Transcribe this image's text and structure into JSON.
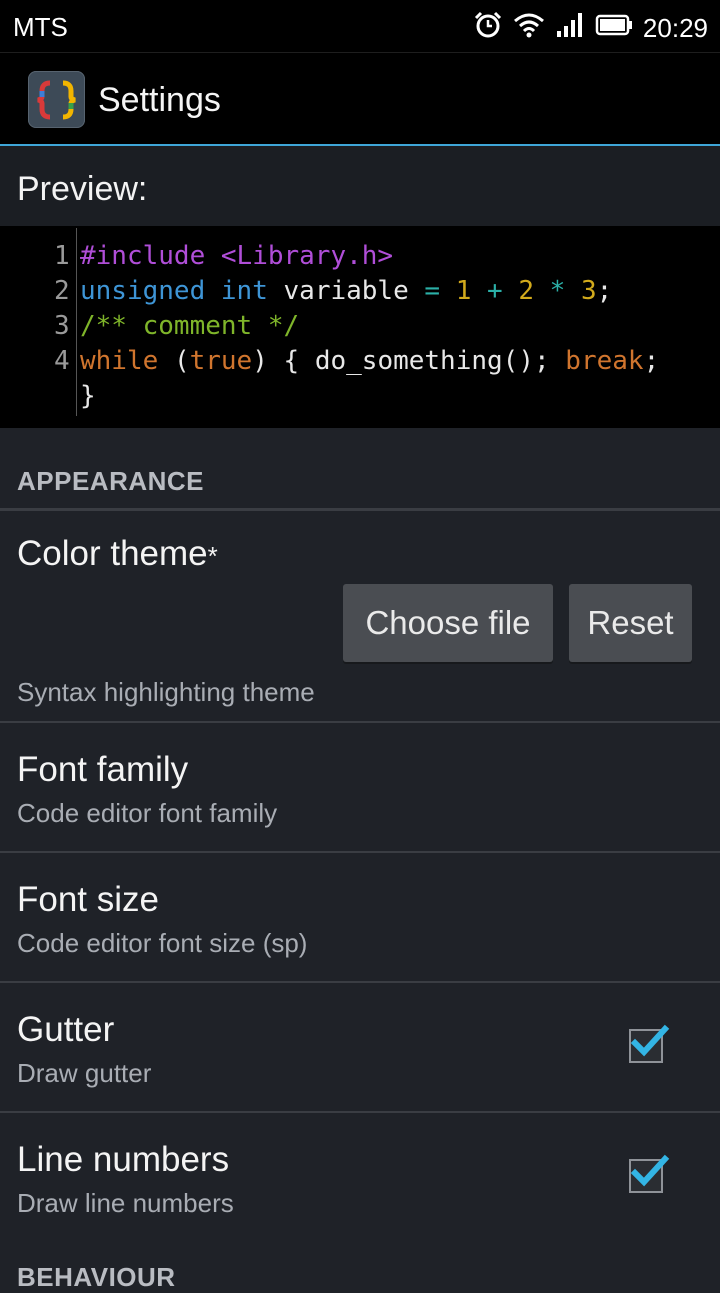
{
  "status_bar": {
    "carrier": "MTS",
    "time": "20:29"
  },
  "app": {
    "title": "Settings"
  },
  "preview": {
    "label": "Preview:",
    "line_numbers": [
      "1",
      "2",
      "3",
      "4"
    ],
    "code": {
      "line1": {
        "directive": "#include",
        "header": "<Library.h>"
      },
      "line2": {
        "kw1": "unsigned",
        "kw2": "int",
        "ident": "variable",
        "op1": "=",
        "n1": "1",
        "op2": "+",
        "n2": "2",
        "op3": "*",
        "n3": "3",
        "end": ";"
      },
      "line3": {
        "comment": "/** comment */"
      },
      "line4": {
        "kw": "while",
        "p1": "(",
        "val": "true",
        "p2": ") { do_something(); ",
        "brk": "break",
        "end": ";"
      },
      "line5": {
        "text": "}"
      }
    }
  },
  "appearance": {
    "category": "APPEARANCE",
    "color_theme": {
      "title": "Color theme",
      "marker": "*",
      "choose_label": "Choose file",
      "reset_label": "Reset",
      "summary": "Syntax highlighting theme"
    },
    "font_family": {
      "title": "Font family",
      "summary": "Code editor font family"
    },
    "font_size": {
      "title": "Font size",
      "summary": "Code editor font size (sp)"
    },
    "gutter": {
      "title": "Gutter",
      "summary": "Draw gutter",
      "checked": true
    },
    "line_numbers": {
      "title": "Line numbers",
      "summary": "Draw line numbers",
      "checked": true
    }
  },
  "behaviour": {
    "category": "BEHAVIOUR"
  },
  "colors": {
    "accent": "#3fa6d8",
    "check": "#33b5e5"
  }
}
